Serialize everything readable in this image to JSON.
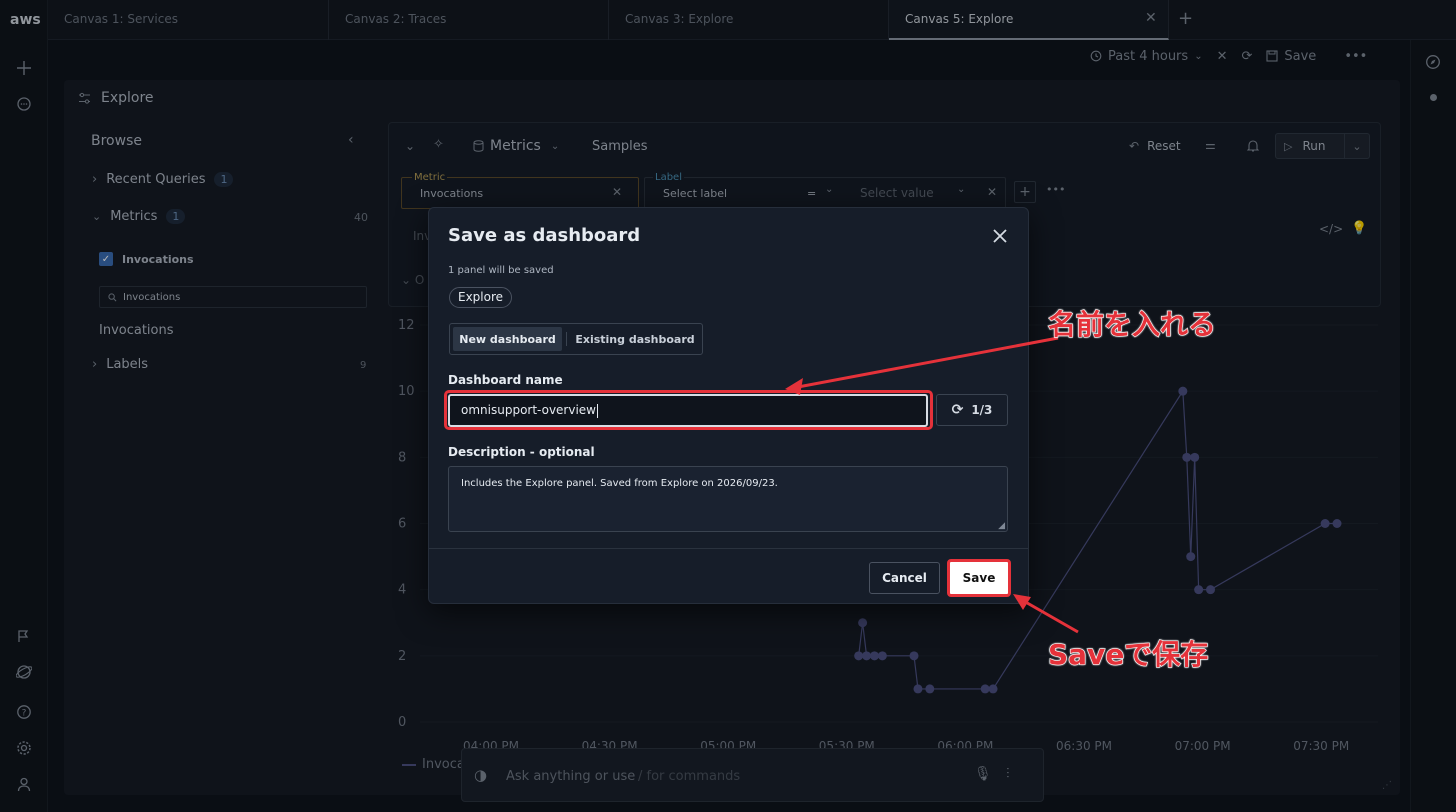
{
  "rail": {
    "logo": "aws"
  },
  "tabs": [
    {
      "label": "Canvas 1: Services"
    },
    {
      "label": "Canvas 2: Traces"
    },
    {
      "label": "Canvas 3: Explore"
    },
    {
      "label": "Canvas 5: Explore",
      "active": true
    }
  ],
  "toolbar": {
    "time_range": "Past 4 hours",
    "save_label": "Save"
  },
  "explore": {
    "title": "Explore",
    "browse_label": "Browse",
    "recent_queries_label": "Recent Queries",
    "recent_queries_count": "1",
    "metrics_label": "Metrics",
    "metrics_count": "1",
    "metrics_total": "40",
    "metric_checked_label": "Invocations",
    "filter_value": "Invocations",
    "metric_item": "Invocations",
    "labels_label": "Labels",
    "labels_count": "9"
  },
  "query": {
    "datasource_label": "Metrics",
    "samples_label": "Samples",
    "reset_label": "Reset",
    "run_label": "Run",
    "metric_field_label": "Metric",
    "metric_value": "Invocations",
    "label_field_label": "Label",
    "label_placeholder": "Select label",
    "operator": "=",
    "value_placeholder": "Select value",
    "input_partial": "Inv",
    "collapsed_partial": "O"
  },
  "chart_data": {
    "type": "line",
    "y_ticks": [
      "12",
      "10",
      "8",
      "6",
      "4",
      "2",
      "0"
    ],
    "x_ticks": [
      "04:00 PM",
      "04:30 PM",
      "05:00 PM",
      "05:30 PM",
      "06:00 PM",
      "06:30 PM",
      "07:00 PM",
      "07:30 PM"
    ],
    "ylim": [
      0,
      12
    ],
    "series": [
      {
        "name": "Invoca",
        "color": "#4b5080"
      }
    ],
    "visible_points": [
      {
        "x": "05:33 PM",
        "y": 2
      },
      {
        "x": "05:34 PM",
        "y": 3
      },
      {
        "x": "05:35 PM",
        "y": 2
      },
      {
        "x": "05:37 PM",
        "y": 2
      },
      {
        "x": "05:39 PM",
        "y": 2
      },
      {
        "x": "05:47 PM",
        "y": 2
      },
      {
        "x": "05:48 PM",
        "y": 1
      },
      {
        "x": "05:51 PM",
        "y": 1
      },
      {
        "x": "06:05 PM",
        "y": 1
      },
      {
        "x": "06:07 PM",
        "y": 1
      },
      {
        "x": "06:55 PM",
        "y": 10
      },
      {
        "x": "06:56 PM",
        "y": 8
      },
      {
        "x": "06:57 PM",
        "y": 5
      },
      {
        "x": "06:58 PM",
        "y": 8
      },
      {
        "x": "06:59 PM",
        "y": 4
      },
      {
        "x": "07:02 PM",
        "y": 4
      },
      {
        "x": "07:31 PM",
        "y": 6
      },
      {
        "x": "07:34 PM",
        "y": 6
      }
    ]
  },
  "assistant": {
    "placeholder": "Ask anything or use",
    "hint": "/ for commands"
  },
  "modal": {
    "title": "Save as dashboard",
    "subtitle": "1 panel will be saved",
    "panel_chip": "Explore",
    "seg_new": "New dashboard",
    "seg_existing": "Existing dashboard",
    "name_label": "Dashboard name",
    "name_value": "omnisupport-overview",
    "suggest_counter": "1/3",
    "desc_label": "Description - optional",
    "desc_value": "Includes the Explore panel. Saved from Explore on 2026/09/23.",
    "cancel_label": "Cancel",
    "save_label": "Save"
  },
  "annotations": {
    "name_hint": "名前を入れる",
    "save_hint": "Saveで保存",
    "color": "#e5323a"
  }
}
